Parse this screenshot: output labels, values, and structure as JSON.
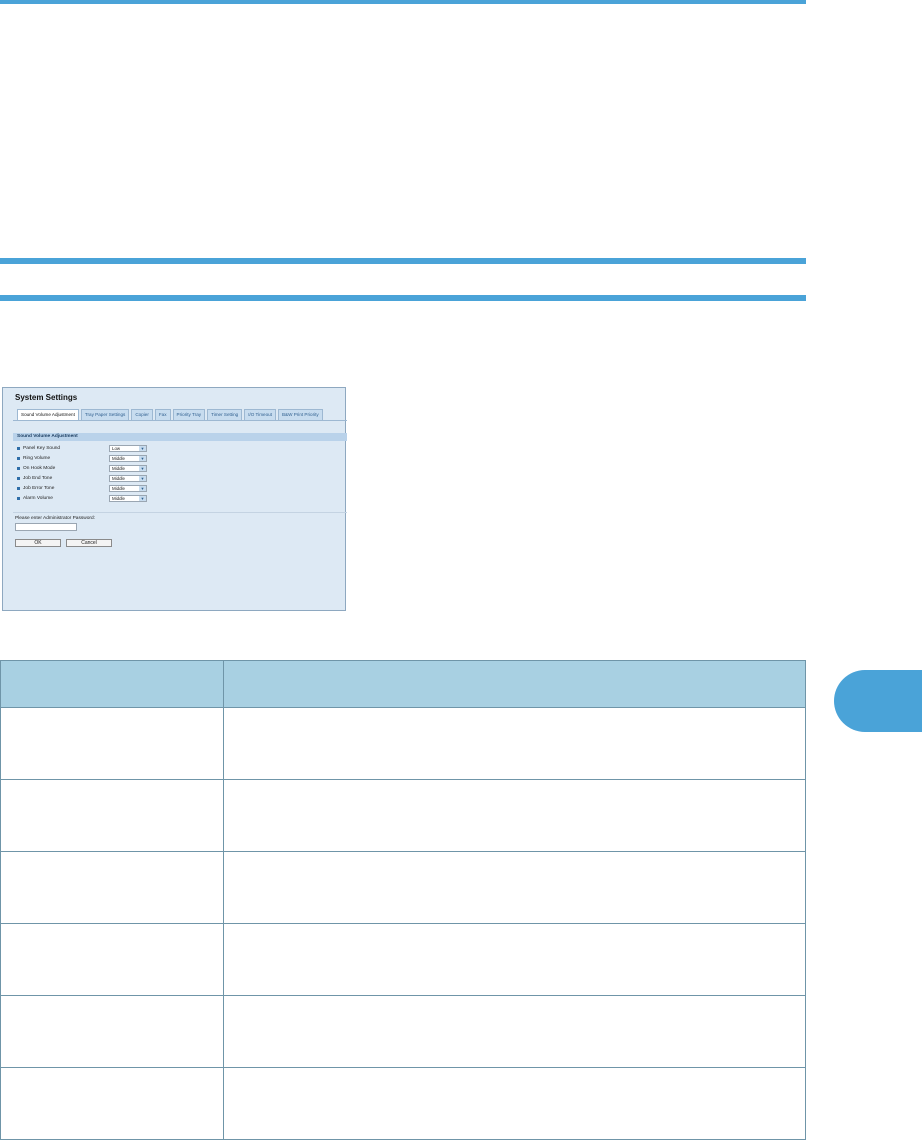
{
  "rules": {
    "accent_color": "#4aa3d8"
  },
  "screenshot": {
    "title": "System Settings",
    "tabs": [
      {
        "label": "Sound Volume Adjustment",
        "active": true
      },
      {
        "label": "Tray Paper Settings",
        "active": false
      },
      {
        "label": "Copier",
        "active": false
      },
      {
        "label": "Fax",
        "active": false
      },
      {
        "label": "Priority Tray",
        "active": false
      },
      {
        "label": "Timer Setting",
        "active": false
      },
      {
        "label": "I/O Timeout",
        "active": false
      },
      {
        "label": "B&W Print Priority",
        "active": false
      }
    ],
    "section_title": "Sound Volume Adjustment",
    "settings": [
      {
        "label": "Panel Key Sound",
        "value": "Low"
      },
      {
        "label": "Ring Volume",
        "value": "Middle"
      },
      {
        "label": "On Hook Mode",
        "value": "Middle"
      },
      {
        "label": "Job End Tone",
        "value": "Middle"
      },
      {
        "label": "Job Error Tone",
        "value": "Middle"
      },
      {
        "label": "Alarm Volume",
        "value": "Middle"
      }
    ],
    "password_label": "Please enter Administrator Password:",
    "password_value": "",
    "ok_label": "OK",
    "cancel_label": "Cancel"
  },
  "table": {
    "headers": [
      "",
      ""
    ],
    "rows": [
      [
        "",
        ""
      ],
      [
        "",
        ""
      ],
      [
        "",
        ""
      ],
      [
        "",
        ""
      ],
      [
        "",
        ""
      ],
      [
        "",
        ""
      ]
    ]
  }
}
